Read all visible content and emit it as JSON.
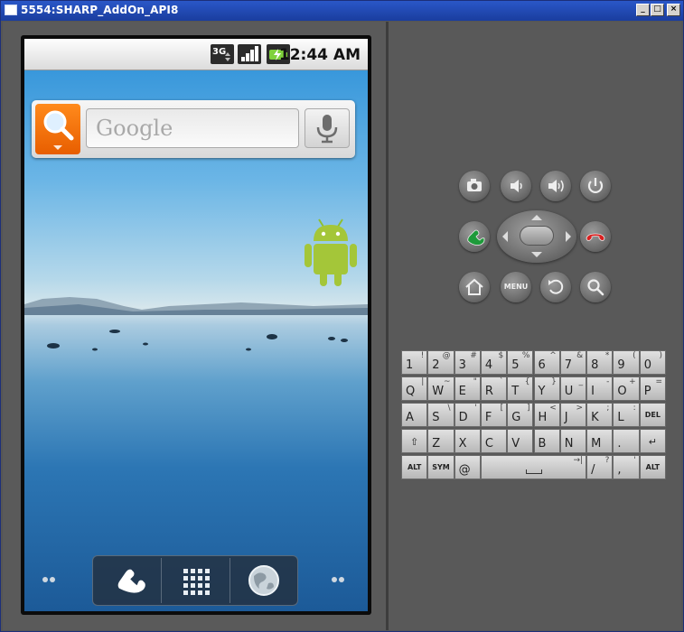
{
  "window": {
    "title": "5554:SHARP_AddOn_API8",
    "minimize_label": "_",
    "maximize_label": "□",
    "close_label": "×"
  },
  "statusbar": {
    "network_type": "3G",
    "time": "12:44 AM"
  },
  "search_widget": {
    "placeholder": "Google"
  },
  "dock": {
    "items": [
      "phone",
      "app-launcher",
      "browser"
    ]
  },
  "controls": {
    "menu_label": "MENU",
    "top_row": [
      "camera",
      "volume-down",
      "volume-up",
      "power"
    ],
    "bottom_row": [
      "home",
      "menu",
      "back",
      "search"
    ]
  },
  "keyboard": {
    "row1": [
      {
        "main": "1",
        "alt": "!"
      },
      {
        "main": "2",
        "alt": "@"
      },
      {
        "main": "3",
        "alt": "#"
      },
      {
        "main": "4",
        "alt": "$"
      },
      {
        "main": "5",
        "alt": "%"
      },
      {
        "main": "6",
        "alt": "^"
      },
      {
        "main": "7",
        "alt": "&"
      },
      {
        "main": "8",
        "alt": "*"
      },
      {
        "main": "9",
        "alt": "("
      },
      {
        "main": "0",
        "alt": ")"
      }
    ],
    "row2": [
      {
        "main": "Q",
        "alt": "|"
      },
      {
        "main": "W",
        "alt": "~"
      },
      {
        "main": "E",
        "alt": "\""
      },
      {
        "main": "R",
        "alt": "`"
      },
      {
        "main": "T",
        "alt": "{"
      },
      {
        "main": "Y",
        "alt": "}"
      },
      {
        "main": "U",
        "alt": "_"
      },
      {
        "main": "I",
        "alt": "-"
      },
      {
        "main": "O",
        "alt": "+"
      },
      {
        "main": "P",
        "alt": "="
      }
    ],
    "row3": [
      {
        "main": "A",
        "alt": ""
      },
      {
        "main": "S",
        "alt": "\\"
      },
      {
        "main": "D",
        "alt": "'"
      },
      {
        "main": "F",
        "alt": "["
      },
      {
        "main": "G",
        "alt": "]"
      },
      {
        "main": "H",
        "alt": "<"
      },
      {
        "main": "J",
        "alt": ">"
      },
      {
        "main": "K",
        "alt": ";"
      },
      {
        "main": "L",
        "alt": ":"
      },
      {
        "main": "DEL",
        "alt": ""
      }
    ],
    "row4": [
      {
        "main": "⇧",
        "alt": ""
      },
      {
        "main": "Z",
        "alt": ""
      },
      {
        "main": "X",
        "alt": ""
      },
      {
        "main": "C",
        "alt": ""
      },
      {
        "main": "V",
        "alt": ""
      },
      {
        "main": "B",
        "alt": ""
      },
      {
        "main": "N",
        "alt": ""
      },
      {
        "main": "M",
        "alt": ""
      },
      {
        "main": ".",
        "alt": ""
      },
      {
        "main": "↵",
        "alt": ""
      }
    ],
    "row5": {
      "alt_left": "ALT",
      "sym": "SYM",
      "at": "@",
      "space_arrow": "→|",
      "slash": "/",
      "slash_alt": "?",
      "comma": ",",
      "comma_alt": "'",
      "alt_right": "ALT"
    }
  }
}
